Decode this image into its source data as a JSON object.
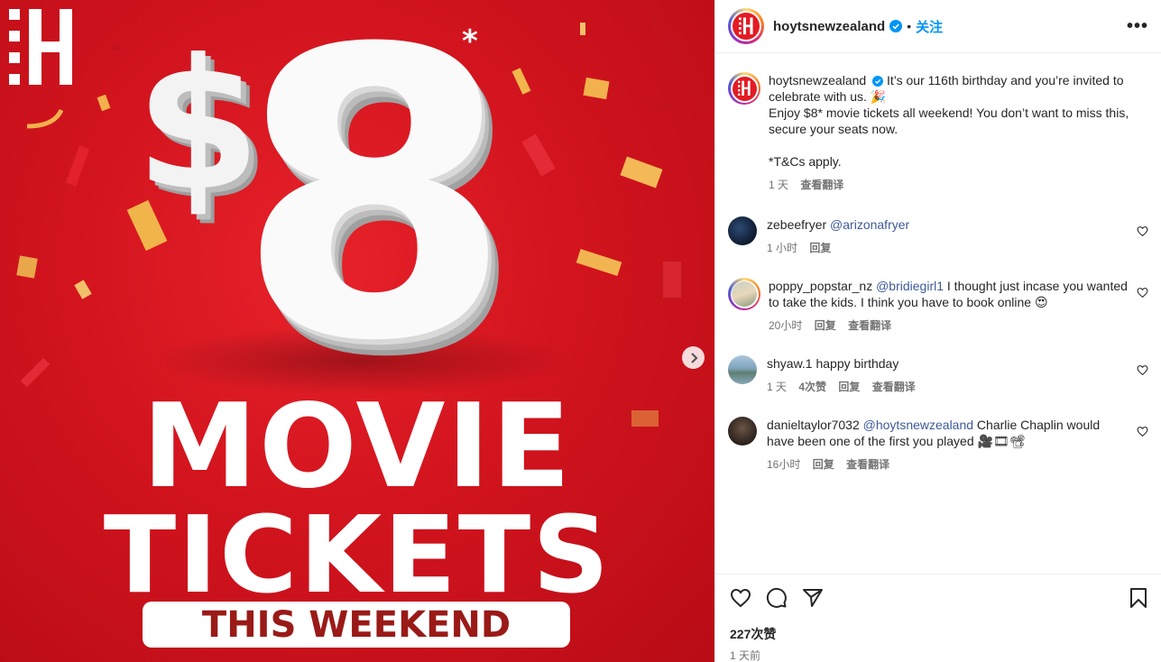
{
  "post_image": {
    "price": "$8",
    "asterisk": "*",
    "line1": "MOVIE",
    "line2": "TICKETS",
    "banner": "THIS WEEKEND",
    "next_icon": "chevron-right-icon",
    "colors": {
      "background": "#d2141e",
      "banner_text": "#9a1a17"
    }
  },
  "header": {
    "username": "hoytsnewzealand",
    "separator": "•",
    "follow_label": "关注",
    "more_icon": "more-horizontal-icon",
    "more_label": "•••"
  },
  "caption": {
    "username": "hoytsnewzealand",
    "text1": "It’s our 116th birthday and you’re invited to celebrate with us. 🎉",
    "text2": "Enjoy $8* movie tickets all weekend! You don’t want to miss this, secure your seats now.",
    "text3": "*T&Cs apply.",
    "time": "1 天",
    "translate": "查看翻译"
  },
  "comments": [
    {
      "username": "zebeefryer",
      "mention": "@arizonafryer",
      "text": "",
      "time": "1 小时",
      "reply": "回复"
    },
    {
      "username": "poppy_popstar_nz",
      "mention": "@bridiegirl1",
      "text": " I thought just incase you wanted to take the kids. I think you have to book online 😍",
      "time": "20小时",
      "reply": "回复",
      "translate": "查看翻译"
    },
    {
      "username": "shyaw.1",
      "text": "happy birthday",
      "time": "1 天",
      "likes": "4次赞",
      "reply": "回复",
      "translate": "查看翻译"
    },
    {
      "username": "danieltaylor7032",
      "mention": "@hoytsnewzealand",
      "text": " Charlie Chaplin would have been one of the first you played 🎥🎞📽",
      "time": "16小时",
      "reply": "回复",
      "translate": "查看翻译"
    }
  ],
  "actions": {
    "likes": "227次赞",
    "posted": "1 天前"
  },
  "colors": {
    "link": "#3d5a98",
    "follow": "#0095f6",
    "meta": "#737373"
  }
}
